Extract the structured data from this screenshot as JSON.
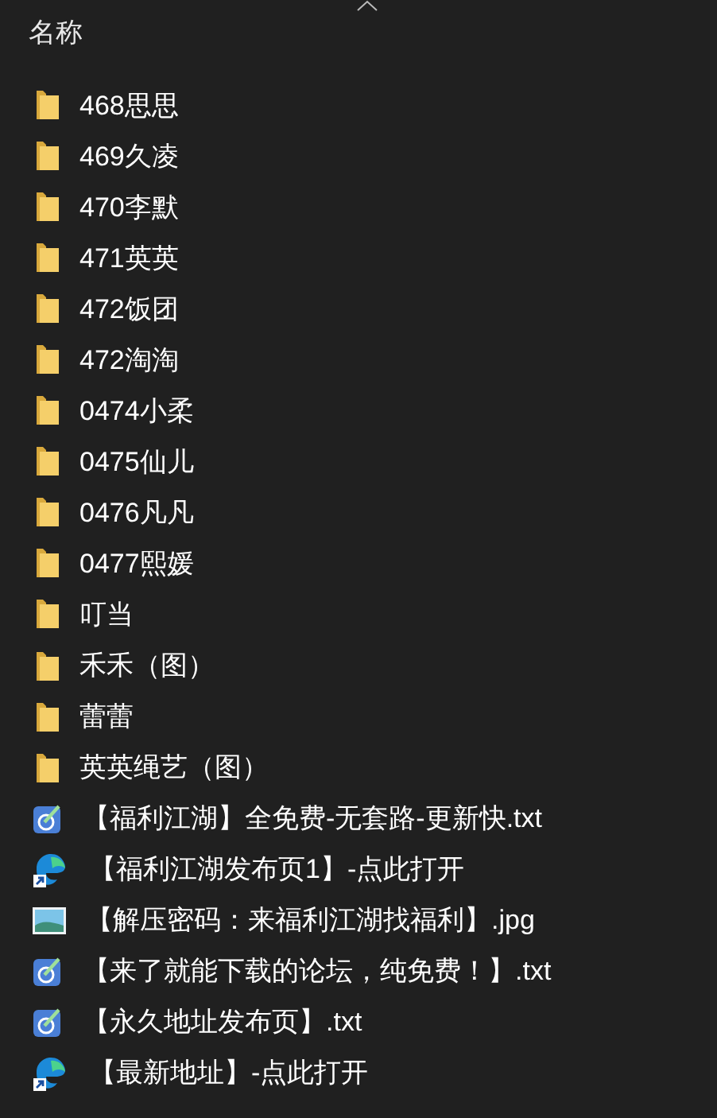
{
  "column_header": {
    "label": "名称",
    "sorted": true
  },
  "files": [
    {
      "kind": "folder",
      "name": "468思思"
    },
    {
      "kind": "folder",
      "name": "469久凌"
    },
    {
      "kind": "folder",
      "name": "470李默"
    },
    {
      "kind": "folder",
      "name": "471英英"
    },
    {
      "kind": "folder",
      "name": "472饭团"
    },
    {
      "kind": "folder",
      "name": "472淘淘"
    },
    {
      "kind": "folder",
      "name": "0474小柔"
    },
    {
      "kind": "folder",
      "name": "0475仙儿"
    },
    {
      "kind": "folder",
      "name": "0476凡凡"
    },
    {
      "kind": "folder",
      "name": "0477熙媛"
    },
    {
      "kind": "folder",
      "name": "叮当"
    },
    {
      "kind": "folder",
      "name": "禾禾（图）"
    },
    {
      "kind": "folder",
      "name": "蕾蕾"
    },
    {
      "kind": "folder",
      "name": "英英绳艺（图）"
    },
    {
      "kind": "text",
      "name": "【福利江湖】全免费-无套路-更新快.txt"
    },
    {
      "kind": "shortcut",
      "name": "【福利江湖发布页1】-点此打开"
    },
    {
      "kind": "image",
      "name": "【解压密码：来福利江湖找福利】.jpg"
    },
    {
      "kind": "text",
      "name": "【来了就能下载的论坛，纯免费！】.txt"
    },
    {
      "kind": "text",
      "name": "【永久地址发布页】.txt"
    },
    {
      "kind": "shortcut",
      "name": "【最新地址】-点此打开"
    }
  ]
}
